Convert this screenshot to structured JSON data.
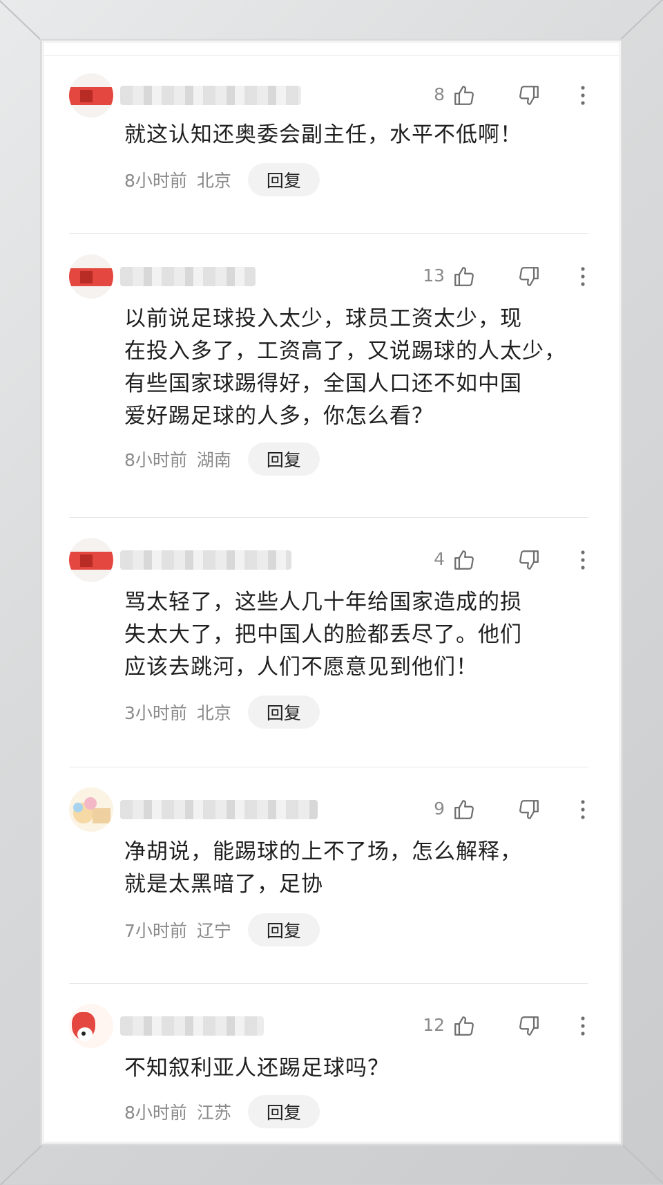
{
  "reply_label": "回复",
  "comments": [
    {
      "likes": "8",
      "text": "就这认知还奥委会副主任，水平不低啊！",
      "time": "8小时前",
      "location": "北京"
    },
    {
      "likes": "13",
      "text": "以前说足球投入太少，球员工资太少，现\n在投入多了，工资高了，又说踢球的人太少，\n有些国家球踢得好，全国人口还不如中国\n爱好踢足球的人多，你怎么看？",
      "time": "8小时前",
      "location": "湖南"
    },
    {
      "likes": "4",
      "text": "骂太轻了，这些人几十年给国家造成的损\n失太大了，把中国人的脸都丢尽了。他们\n应该去跳河，人们不愿意见到他们！",
      "time": "3小时前",
      "location": "北京"
    },
    {
      "likes": "9",
      "text": "净胡说，能踢球的上不了场，怎么解释，\n就是太黑暗了，足协",
      "time": "7小时前",
      "location": "辽宁"
    },
    {
      "likes": "12",
      "text": "不知叙利亚人还踢足球吗？",
      "time": "8小时前",
      "location": "江苏"
    }
  ],
  "icons": {
    "like": "thumbs-up-icon",
    "dislike": "thumbs-down-icon",
    "more": "more-vertical-icon"
  },
  "colors": {
    "text": "#1f1f1f",
    "meta": "#8a8a8a",
    "reply_bg": "#f2f2f2",
    "avatar_red": "#e4473f"
  }
}
